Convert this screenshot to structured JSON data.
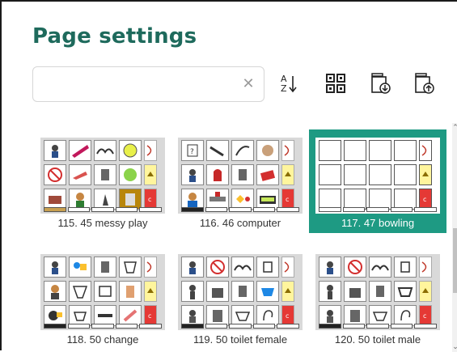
{
  "title": "Page settings",
  "search": {
    "value": "",
    "placeholder": ""
  },
  "toolbar": {
    "sort_icon": "sort-az-icon",
    "qr_icon": "qr-code-icon",
    "import_icon": "import-pages-icon",
    "export_icon": "export-pages-icon"
  },
  "pages": [
    {
      "label": "115. 45 messy play",
      "selected": false,
      "blank": false
    },
    {
      "label": "116. 46 computer",
      "selected": false,
      "blank": false
    },
    {
      "label": "117. 47 bowling",
      "selected": true,
      "blank": true
    },
    {
      "label": "118. 50 change",
      "selected": false,
      "blank": false
    },
    {
      "label": "119. 50 toilet female",
      "selected": false,
      "blank": false
    },
    {
      "label": "120. 50 toilet male",
      "selected": false,
      "blank": false
    }
  ],
  "colors": {
    "accent": "#1e9a83",
    "title": "#1e6a5c"
  }
}
